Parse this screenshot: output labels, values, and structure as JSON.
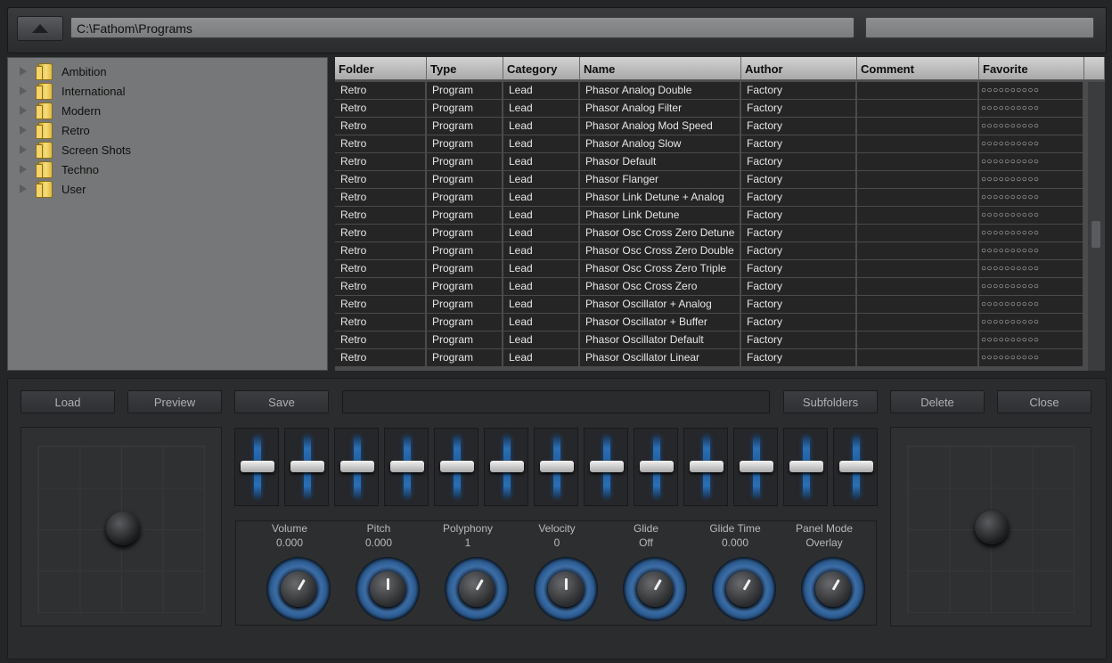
{
  "path": "C:\\Fathom\\Programs",
  "search": "",
  "tree": [
    "Ambition",
    "International",
    "Modern",
    "Retro",
    "Screen Shots",
    "Techno",
    "User"
  ],
  "columns": [
    "Folder",
    "Type",
    "Category",
    "Name",
    "Author",
    "Comment",
    "Favorite"
  ],
  "favorite_marks": "○○○○○○○○○○",
  "rows": [
    {
      "folder": "Retro",
      "type": "Program",
      "category": "Lead",
      "name": "Phasor Analog Double",
      "author": "Factory",
      "comment": ""
    },
    {
      "folder": "Retro",
      "type": "Program",
      "category": "Lead",
      "name": "Phasor Analog Filter",
      "author": "Factory",
      "comment": ""
    },
    {
      "folder": "Retro",
      "type": "Program",
      "category": "Lead",
      "name": "Phasor Analog Mod Speed",
      "author": "Factory",
      "comment": ""
    },
    {
      "folder": "Retro",
      "type": "Program",
      "category": "Lead",
      "name": "Phasor Analog Slow",
      "author": "Factory",
      "comment": ""
    },
    {
      "folder": "Retro",
      "type": "Program",
      "category": "Lead",
      "name": "Phasor Default",
      "author": "Factory",
      "comment": ""
    },
    {
      "folder": "Retro",
      "type": "Program",
      "category": "Lead",
      "name": "Phasor Flanger",
      "author": "Factory",
      "comment": ""
    },
    {
      "folder": "Retro",
      "type": "Program",
      "category": "Lead",
      "name": "Phasor Link Detune + Analog",
      "author": "Factory",
      "comment": ""
    },
    {
      "folder": "Retro",
      "type": "Program",
      "category": "Lead",
      "name": "Phasor Link Detune",
      "author": "Factory",
      "comment": ""
    },
    {
      "folder": "Retro",
      "type": "Program",
      "category": "Lead",
      "name": "Phasor Osc Cross Zero Detune",
      "author": "Factory",
      "comment": ""
    },
    {
      "folder": "Retro",
      "type": "Program",
      "category": "Lead",
      "name": "Phasor Osc Cross Zero Double",
      "author": "Factory",
      "comment": ""
    },
    {
      "folder": "Retro",
      "type": "Program",
      "category": "Lead",
      "name": "Phasor Osc Cross Zero Triple",
      "author": "Factory",
      "comment": ""
    },
    {
      "folder": "Retro",
      "type": "Program",
      "category": "Lead",
      "name": "Phasor Osc Cross Zero",
      "author": "Factory",
      "comment": ""
    },
    {
      "folder": "Retro",
      "type": "Program",
      "category": "Lead",
      "name": "Phasor Oscillator + Analog",
      "author": "Factory",
      "comment": ""
    },
    {
      "folder": "Retro",
      "type": "Program",
      "category": "Lead",
      "name": "Phasor Oscillator + Buffer",
      "author": "Factory",
      "comment": ""
    },
    {
      "folder": "Retro",
      "type": "Program",
      "category": "Lead",
      "name": "Phasor Oscillator Default",
      "author": "Factory",
      "comment": ""
    },
    {
      "folder": "Retro",
      "type": "Program",
      "category": "Lead",
      "name": "Phasor Oscillator Linear",
      "author": "Factory",
      "comment": ""
    }
  ],
  "buttons": {
    "load": "Load",
    "preview": "Preview",
    "save": "Save",
    "subfolders": "Subfolders",
    "delete": "Delete",
    "close": "Close"
  },
  "name_field": "",
  "slider_count": 13,
  "params": [
    {
      "label": "Volume",
      "value": "0.000",
      "knob_angle": 30
    },
    {
      "label": "Pitch",
      "value": "0.000",
      "knob_angle": 0
    },
    {
      "label": "Polyphony",
      "value": "1",
      "knob_angle": 30
    },
    {
      "label": "Velocity",
      "value": "0",
      "knob_angle": 0
    },
    {
      "label": "Glide",
      "value": "Off",
      "knob_angle": 30
    },
    {
      "label": "Glide Time",
      "value": "0.000",
      "knob_angle": 30
    },
    {
      "label": "Panel Mode",
      "value": "Overlay",
      "knob_angle": 30
    }
  ],
  "colors": {
    "accent_blue": "#2a6fb5",
    "table_row": "#252525",
    "header": "#c4c4c4"
  }
}
